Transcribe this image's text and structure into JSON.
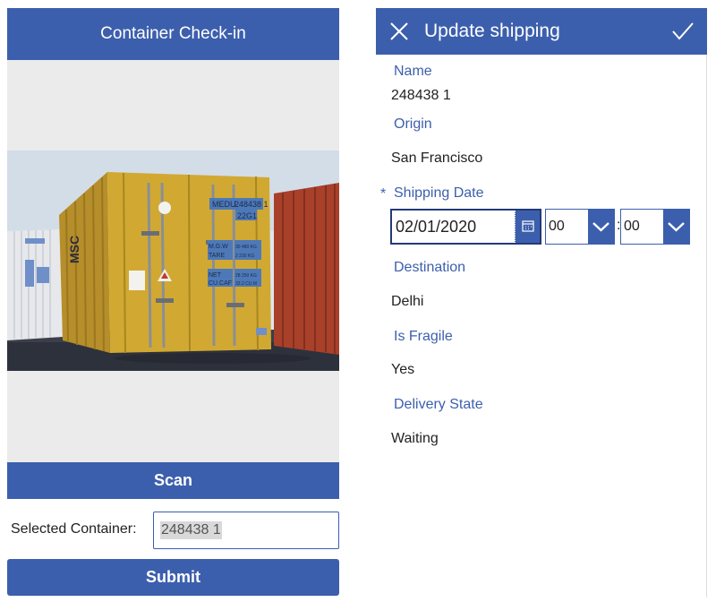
{
  "left": {
    "title": "Container Check-in",
    "scan_label": "Scan",
    "selected_label": "Selected Container:",
    "selected_value": "248438 1",
    "submit_label": "Submit",
    "image_alt": "Yellow shipping container",
    "container_marks": {
      "owner": "MEDU",
      "number": "248438 1",
      "type_code": "22G1",
      "mgw": "M.G.W",
      "tare": "TARE",
      "net": "NET",
      "cu_cap": "CU.CAF",
      "mgw_value": "30 480 KG",
      "tare_value": "2 230 KG",
      "net_value": "28 250 KG",
      "cap_value": "33.2 CU.M"
    }
  },
  "right": {
    "title": "Update shipping",
    "fields": [
      {
        "label": "Name",
        "value": "248438 1"
      },
      {
        "label": "Origin",
        "value": "San Francisco"
      },
      {
        "label": "Shipping Date",
        "required_mark": "*"
      },
      {
        "label": "Destination",
        "value": "Delhi"
      },
      {
        "label": "Is Fragile",
        "value": "Yes"
      },
      {
        "label": "Delivery State",
        "value": "Waiting"
      }
    ],
    "date_value": "02/01/2020",
    "hour_value": "00",
    "minute_value": "00",
    "time_separator": ":"
  },
  "colors": {
    "accent": "#3c5fad",
    "accent_dark": "#233a78",
    "background": "#ffffff",
    "photo_bg": "#ebebeb",
    "container_yellow": "#d1a932",
    "container_red": "#a8402a"
  },
  "icons": {
    "close": "close-icon",
    "confirm": "checkmark-icon",
    "calendar": "calendar-icon",
    "dropdown": "chevron-down-icon"
  }
}
